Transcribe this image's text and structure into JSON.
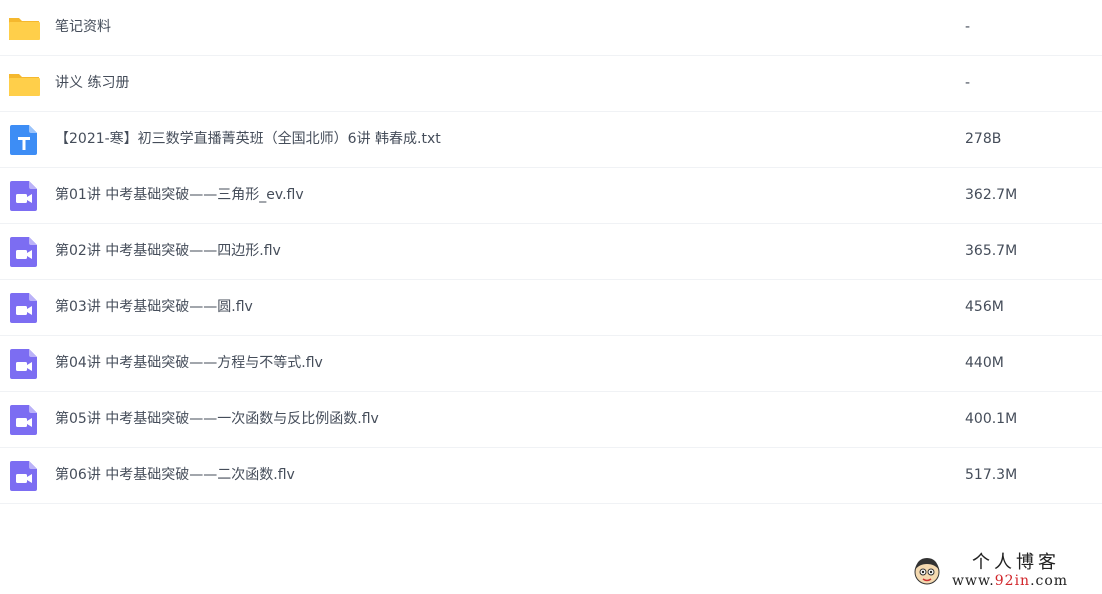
{
  "files": [
    {
      "type": "folder",
      "icon": "folder-icon",
      "name": "笔记资料",
      "size": "-"
    },
    {
      "type": "folder",
      "icon": "folder-icon",
      "name": "讲义 练习册",
      "size": "-"
    },
    {
      "type": "text",
      "icon": "text-file-icon",
      "name": "【2021-寒】初三数学直播菁英班（全国北师）6讲 韩春成.txt",
      "size": "278B"
    },
    {
      "type": "video",
      "icon": "video-file-icon",
      "name": "第01讲 中考基础突破——三角形_ev.flv",
      "size": "362.7M"
    },
    {
      "type": "video",
      "icon": "video-file-icon",
      "name": "第02讲 中考基础突破——四边形.flv",
      "size": "365.7M"
    },
    {
      "type": "video",
      "icon": "video-file-icon",
      "name": "第03讲 中考基础突破——圆.flv",
      "size": "456M"
    },
    {
      "type": "video",
      "icon": "video-file-icon",
      "name": "第04讲 中考基础突破——方程与不等式.flv",
      "size": "440M"
    },
    {
      "type": "video",
      "icon": "video-file-icon",
      "name": "第05讲 中考基础突破——一次函数与反比例函数.flv",
      "size": "400.1M"
    },
    {
      "type": "video",
      "icon": "video-file-icon",
      "name": "第06讲 中考基础突破——二次函数.flv",
      "size": "517.3M"
    }
  ],
  "watermark": {
    "title": "个人博客",
    "url_prefix": "www.",
    "url_highlight": "92in",
    "url_suffix": ".com"
  },
  "colors": {
    "folder": "#ffcf4a",
    "text_icon": "#3d8df5",
    "video_icon": "#7c6df2",
    "row_divider": "#f0f2f5",
    "text": "#454d5a"
  }
}
